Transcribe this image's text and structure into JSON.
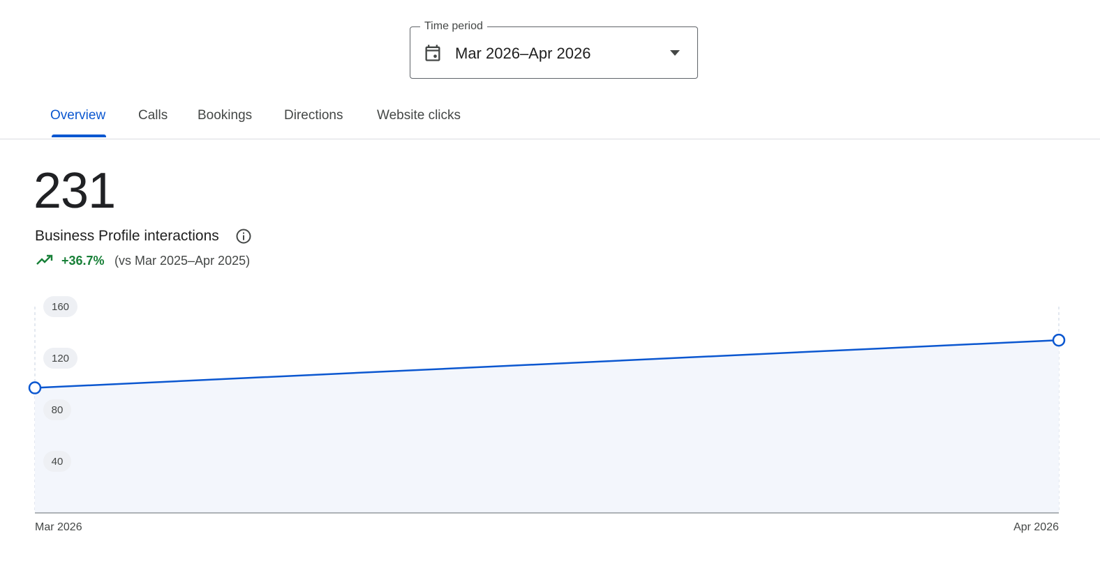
{
  "time_period": {
    "label": "Time period",
    "value": "Mar 2026–Apr 2026",
    "icon": "calendar-icon"
  },
  "tabs": [
    {
      "label": "Overview",
      "active": true
    },
    {
      "label": "Calls",
      "active": false
    },
    {
      "label": "Bookings",
      "active": false
    },
    {
      "label": "Directions",
      "active": false
    },
    {
      "label": "Website clicks",
      "active": false
    }
  ],
  "metric": {
    "value": "231",
    "label": "Business Profile interactions",
    "change": "+36.7%",
    "comparison": "(vs Mar 2025–Apr 2025)"
  },
  "colors": {
    "accent": "#0b57d0",
    "positive": "#188038",
    "area_fill": "#f3f6fc"
  },
  "chart_data": {
    "type": "area",
    "categories": [
      "Mar 2026",
      "Apr 2026"
    ],
    "values": [
      97,
      134
    ],
    "yticks": [
      40,
      80,
      120,
      160
    ],
    "ylim": [
      0,
      160
    ],
    "grid": false,
    "title": "",
    "xlabel": "",
    "ylabel": ""
  }
}
